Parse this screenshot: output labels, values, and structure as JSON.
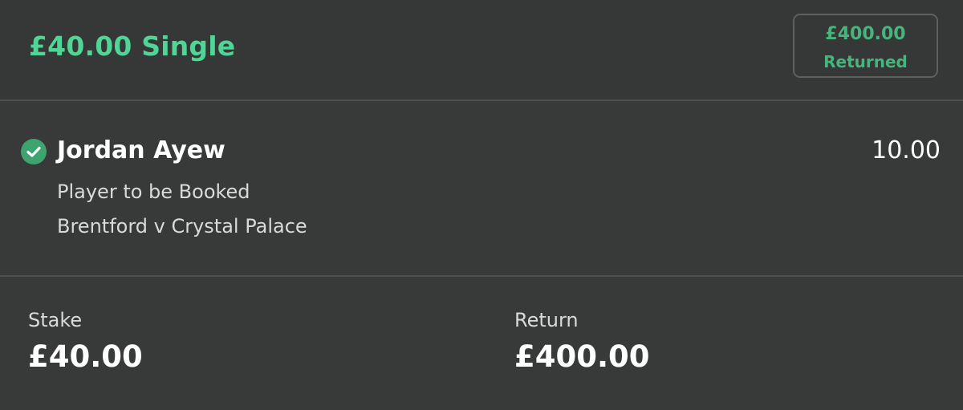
{
  "bet": {
    "title": "£40.00 Single",
    "status": {
      "amount": "£400.00",
      "label": "Returned"
    },
    "selection": {
      "status_icon": "check-circle-icon",
      "name": "Jordan Ayew",
      "odds": "10.00",
      "market": "Player to be Booked",
      "event": "Brentford v Crystal Palace"
    },
    "summary": {
      "stake_label": "Stake",
      "stake_value": "£40.00",
      "return_label": "Return",
      "return_value": "£400.00"
    }
  },
  "colors": {
    "background": "#373a38",
    "accent_green": "#4fd696",
    "badge_green": "#47b47d",
    "badge_border": "#5d605e",
    "divider": "#4c4f4d",
    "check_circle": "#3fa36f",
    "primary_text": "#ffffff",
    "secondary_text": "#d9dad9"
  }
}
